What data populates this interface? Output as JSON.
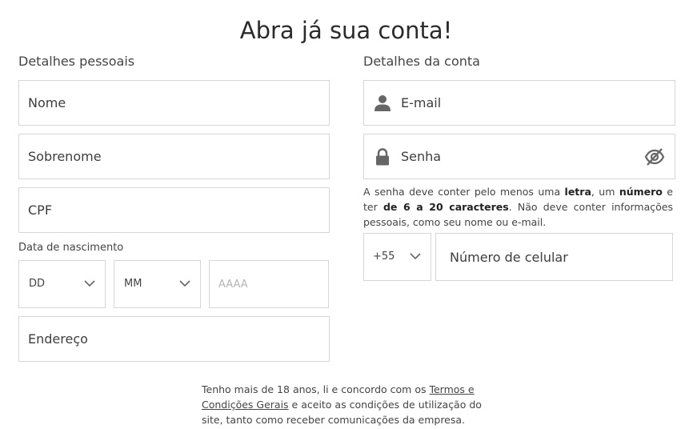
{
  "page": {
    "title": "Abra já sua conta!"
  },
  "personal": {
    "label": "Detalhes pessoais",
    "first_name_placeholder": "Nome",
    "last_name_placeholder": "Sobrenome",
    "cpf_placeholder": "CPF",
    "dob_label": "Data de nascimento",
    "day_value": "DD",
    "month_value": "MM",
    "year_placeholder": "AAAA",
    "address_placeholder": "Endereço"
  },
  "account": {
    "label": "Detalhes da conta",
    "email_placeholder": "E-mail",
    "password_placeholder": "Senha",
    "hint_part1": "A senha deve conter pelo menos uma ",
    "hint_letter": "letra",
    "hint_part2": ", um ",
    "hint_number": "número",
    "hint_part3": " e ter ",
    "hint_length": "de 6 a 20 caracteres",
    "hint_part4": ". Não deve conter informações pessoais, como seu nome ou e-mail.",
    "country_code": "+55",
    "phone_placeholder": "Número de celular"
  },
  "terms": {
    "part1": "Tenho mais de 18 anos, li e concordo com os ",
    "link": "Termos e Condições Gerais",
    "part2": " e aceito as condições de utilização do site, tanto como receber comunicações da empresa."
  },
  "colors": {
    "border": "#d6d6d6",
    "icon": "#666666",
    "text": "#333333"
  },
  "icons": [
    "user-icon",
    "lock-icon",
    "eye-off-icon",
    "chevron-down-icon"
  ]
}
